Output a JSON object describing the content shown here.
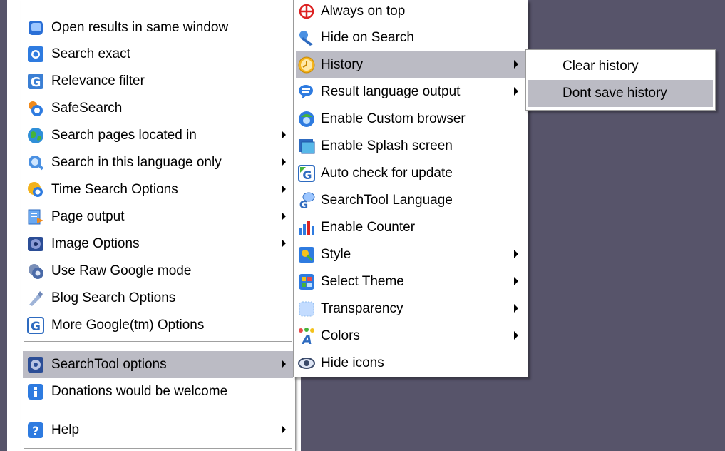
{
  "main_menu": {
    "items": [
      {
        "label": "Open results in same window",
        "icon": "window-icon"
      },
      {
        "label": "Search exact",
        "icon": "search-exact-icon"
      },
      {
        "label": "Relevance filter",
        "icon": "google-g-icon"
      },
      {
        "label": "SafeSearch",
        "icon": "safesearch-icon"
      },
      {
        "label": "Search pages located in",
        "icon": "globe-icon",
        "submenu": true
      },
      {
        "label": "Search in this language only",
        "icon": "language-search-icon",
        "submenu": true
      },
      {
        "label": "Time Search Options",
        "icon": "clock-search-icon",
        "submenu": true
      },
      {
        "label": "Page output",
        "icon": "page-output-icon",
        "submenu": true
      },
      {
        "label": "Image Options",
        "icon": "image-options-icon",
        "submenu": true
      },
      {
        "label": "Use Raw Google mode",
        "icon": "raw-mode-icon"
      },
      {
        "label": "Blog Search Options",
        "icon": "blog-icon"
      },
      {
        "label": "More Google(tm) Options",
        "icon": "google-options-icon"
      }
    ],
    "searchtool_options": "SearchTool options",
    "donations": "Donations would be welcome",
    "help": "Help"
  },
  "options_submenu": {
    "items": [
      {
        "label": "Always on top",
        "icon": "pin-icon"
      },
      {
        "label": "Hide on Search",
        "icon": "hide-search-icon"
      },
      {
        "label": "History",
        "icon": "history-clock-icon",
        "submenu": true,
        "highlighted": true
      },
      {
        "label": "Result language output",
        "icon": "result-language-icon",
        "submenu": true
      },
      {
        "label": "Enable Custom browser",
        "icon": "browser-icon"
      },
      {
        "label": "Enable Splash screen",
        "icon": "splash-icon"
      },
      {
        "label": "Auto check for update",
        "icon": "update-icon"
      },
      {
        "label": "SearchTool Language",
        "icon": "tool-language-icon"
      },
      {
        "label": "Enable Counter",
        "icon": "counter-chart-icon"
      },
      {
        "label": "Style",
        "icon": "style-icon",
        "submenu": true
      },
      {
        "label": "Select Theme",
        "icon": "theme-icon",
        "submenu": true
      },
      {
        "label": "Transparency",
        "icon": "transparency-icon",
        "submenu": true
      },
      {
        "label": "Colors",
        "icon": "colors-icon",
        "submenu": true
      },
      {
        "label": "Hide icons",
        "icon": "hide-icons-icon"
      }
    ]
  },
  "history_submenu": {
    "clear": "Clear history",
    "dont_save": "Dont save history"
  },
  "colors": {
    "highlight": "#bbbbc4",
    "desktop": "#57546a"
  }
}
